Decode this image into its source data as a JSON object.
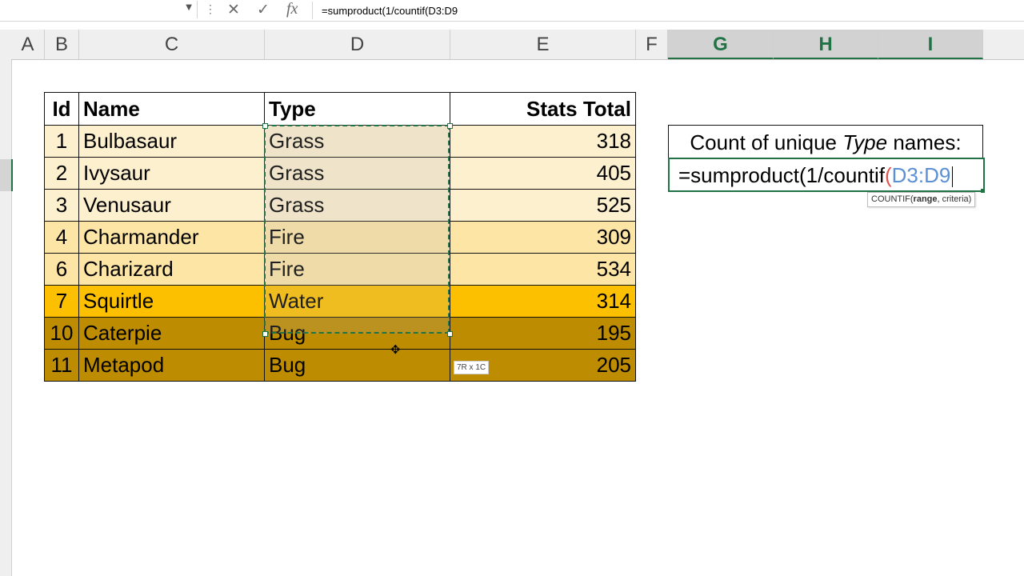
{
  "formula_bar": {
    "dots": "⋮",
    "cancel_icon": "✕",
    "enter_icon": "✓",
    "fx_label": "fx",
    "formula": "=sumproduct(1/countif(D3:D9"
  },
  "columns": [
    "A",
    "B",
    "C",
    "D",
    "E",
    "F",
    "G",
    "H",
    "I"
  ],
  "selected_columns": [
    "G",
    "H",
    "I"
  ],
  "table": {
    "headers": [
      "Id",
      "Name",
      "Type",
      "Stats Total"
    ],
    "rows": [
      {
        "id": "1",
        "name": "Bulbasaur",
        "type": "Grass",
        "stats": "318",
        "bg": "#fdf0cf"
      },
      {
        "id": "2",
        "name": "Ivysaur",
        "type": "Grass",
        "stats": "405",
        "bg": "#fdf0cf"
      },
      {
        "id": "3",
        "name": "Venusaur",
        "type": "Grass",
        "stats": "525",
        "bg": "#fdf0cf"
      },
      {
        "id": "4",
        "name": "Charmander",
        "type": "Fire",
        "stats": "309",
        "bg": "#fde5a6"
      },
      {
        "id": "6",
        "name": "Charizard",
        "type": "Fire",
        "stats": "534",
        "bg": "#fde5a6"
      },
      {
        "id": "7",
        "name": "Squirtle",
        "type": "Water",
        "stats": "314",
        "bg": "#fdc000"
      },
      {
        "id": "10",
        "name": "Caterpie",
        "type": "Bug",
        "stats": "195",
        "bg": "#be8c00"
      },
      {
        "id": "11",
        "name": "Metapod",
        "type": "Bug",
        "stats": "205",
        "bg": "#be8c00"
      }
    ]
  },
  "unique_box": {
    "title_prefix": "Count of unique ",
    "title_italic": "Type",
    "title_suffix": "  names:",
    "formula_start": "=sumproduct(1/countif",
    "formula_paren": "(",
    "formula_ref": "D3:D9"
  },
  "tooltip": {
    "fn": "COUNTIF(",
    "arg1": "range",
    "rest": ", criteria)"
  },
  "size_tip": "7R x 1C",
  "colors": {
    "accent_green": "#217346",
    "ref_blue": "#5b8fd6",
    "paren_red": "#e0524b"
  }
}
